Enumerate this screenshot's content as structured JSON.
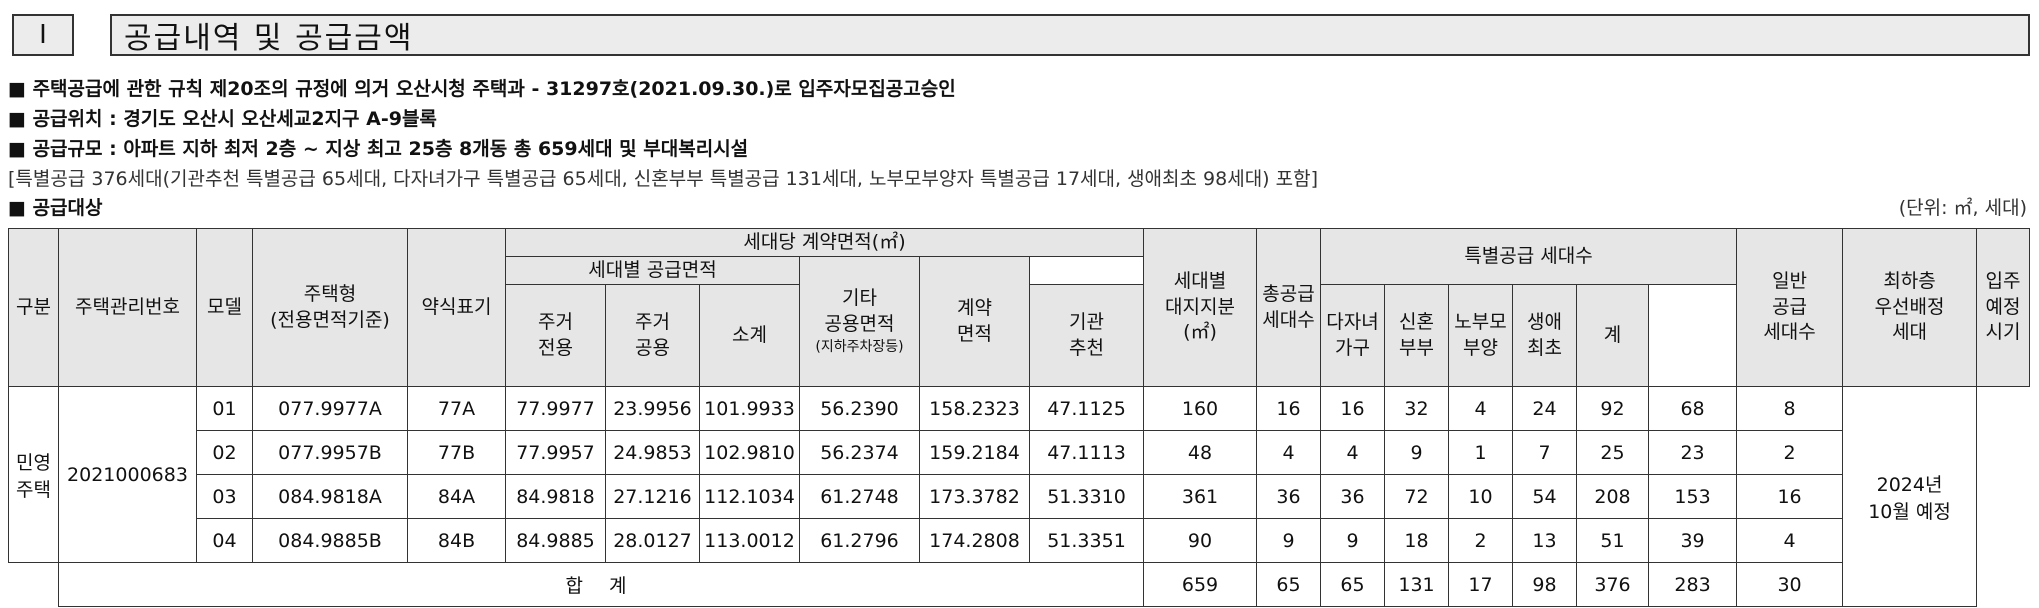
{
  "section": {
    "roman": "Ⅰ",
    "title": "공급내역 및 공급금액"
  },
  "notes": {
    "approval": "■ 주택공급에 관한 규칙 제20조의 규정에 의거 오산시청 주택과 - 31297호(2021.09.30.)로 입주자모집공고승인",
    "location": "■ 공급위치 : 경기도 오산시 오산세교2지구 A-9블록",
    "scale": "■ 공급규모 : 아파트 지하 최저 2층 ~ 지상 최고 25층 8개동 총 659세대 및 부대복리시설",
    "special_breakdown": "[특별공급 376세대(기관추천 특별공급 65세대, 다자녀가구 특별공급 65세대, 신혼부부 특별공급 131세대, 노부모부양자 특별공급 17세대, 생애최초 98세대) 포함]",
    "target": "■ 공급대상",
    "unit": "(단위: ㎡, 세대)"
  },
  "table": {
    "headers": {
      "category": "구분",
      "mgmt_no": "주택관리번호",
      "model": "모델",
      "type_l1": "주택형",
      "type_l2": "(전용면적기준)",
      "abbr": "약식표기",
      "contract_area_group": "세대당 계약면적(㎡)",
      "supply_area_group": "세대별 공급면적",
      "excl_l1": "주거",
      "excl_l2": "전용",
      "common_l1": "주거",
      "common_l2": "공용",
      "subtotal": "소계",
      "other_l1": "기타",
      "other_l2": "공용면적",
      "other_l3": "(지하주차장등)",
      "contract_l1": "계약",
      "contract_l2": "면적",
      "land_l1": "세대별",
      "land_l2": "대지지분",
      "land_l3": "(㎡)",
      "total_l1": "총공급",
      "total_l2": "세대수",
      "special_group": "특별공급 세대수",
      "inst_l1": "기관",
      "inst_l2": "추천",
      "multi_l1": "다자녀",
      "multi_l2": "가구",
      "newly_l1": "신혼",
      "newly_l2": "부부",
      "elder_l1": "노부모",
      "elder_l2": "부양",
      "first_l1": "생애",
      "first_l2": "최초",
      "sum": "계",
      "general_l1": "일반",
      "general_l2": "공급",
      "general_l3": "세대수",
      "low_l1": "최하층",
      "low_l2": "우선배정",
      "low_l3": "세대",
      "move_l1": "입주",
      "move_l2": "예정",
      "move_l3": "시기"
    },
    "category_l1": "민영",
    "category_l2": "주택",
    "mgmt_no": "2021000683",
    "move_in_l1": "2024년",
    "move_in_l2": "10월 예정",
    "rows": [
      {
        "model": "01",
        "type": "077.9977A",
        "abbr": "77A",
        "excl": "77.9977",
        "common": "23.9956",
        "subtotal": "101.9933",
        "other": "56.2390",
        "contract": "158.2323",
        "land": "47.1125",
        "total": "160",
        "inst": "16",
        "multi": "16",
        "newly": "32",
        "elder": "4",
        "first": "24",
        "sum": "92",
        "general": "68",
        "low": "8"
      },
      {
        "model": "02",
        "type": "077.9957B",
        "abbr": "77B",
        "excl": "77.9957",
        "common": "24.9853",
        "subtotal": "102.9810",
        "other": "56.2374",
        "contract": "159.2184",
        "land": "47.1113",
        "total": "48",
        "inst": "4",
        "multi": "4",
        "newly": "9",
        "elder": "1",
        "first": "7",
        "sum": "25",
        "general": "23",
        "low": "2"
      },
      {
        "model": "03",
        "type": "084.9818A",
        "abbr": "84A",
        "excl": "84.9818",
        "common": "27.1216",
        "subtotal": "112.1034",
        "other": "61.2748",
        "contract": "173.3782",
        "land": "51.3310",
        "total": "361",
        "inst": "36",
        "multi": "36",
        "newly": "72",
        "elder": "10",
        "first": "54",
        "sum": "208",
        "general": "153",
        "low": "16"
      },
      {
        "model": "04",
        "type": "084.9885B",
        "abbr": "84B",
        "excl": "84.9885",
        "common": "28.0127",
        "subtotal": "113.0012",
        "other": "61.2796",
        "contract": "174.2808",
        "land": "51.3351",
        "total": "90",
        "inst": "9",
        "multi": "9",
        "newly": "18",
        "elder": "2",
        "first": "13",
        "sum": "51",
        "general": "39",
        "low": "4"
      }
    ],
    "totals": {
      "label": "합 계",
      "total": "659",
      "inst": "65",
      "multi": "65",
      "newly": "131",
      "elder": "17",
      "first": "98",
      "sum": "376",
      "general": "283",
      "low": "30"
    }
  }
}
